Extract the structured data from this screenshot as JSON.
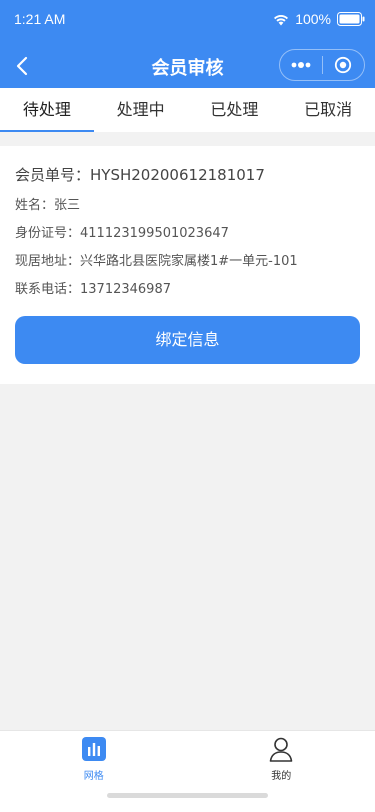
{
  "status_bar": {
    "time": "1:21 AM",
    "battery": "100%",
    "wifi_icon": "wifi-icon",
    "battery_icon": "battery-icon"
  },
  "nav": {
    "title": "会员审核",
    "back_icon": "chevron-left-icon",
    "more_icon": "more-dots-icon",
    "close_icon": "target-circle-icon"
  },
  "tabs": [
    {
      "label": "待处理",
      "active": true
    },
    {
      "label": "处理中",
      "active": false
    },
    {
      "label": "已处理",
      "active": false
    },
    {
      "label": "已取消",
      "active": false
    }
  ],
  "record": {
    "order_label": "会员单号：",
    "order_value": "HYSH20200612181017",
    "name_label": "姓名：",
    "name_value": "张三",
    "id_label": "身份证号：",
    "id_value": "411123199501023647",
    "address_label": "现居地址：",
    "address_value": "兴华路北县医院家属楼1#一单元-101",
    "phone_label": "联系电话：",
    "phone_value": "13712346987",
    "bind_button": "绑定信息"
  },
  "tabbar": [
    {
      "label": "网格",
      "icon": "bar-chart-icon",
      "active": true
    },
    {
      "label": "我的",
      "icon": "user-icon",
      "active": false
    }
  ],
  "colors": {
    "primary": "#3d8af2",
    "background": "#f2f2f2",
    "text": "#333333"
  }
}
